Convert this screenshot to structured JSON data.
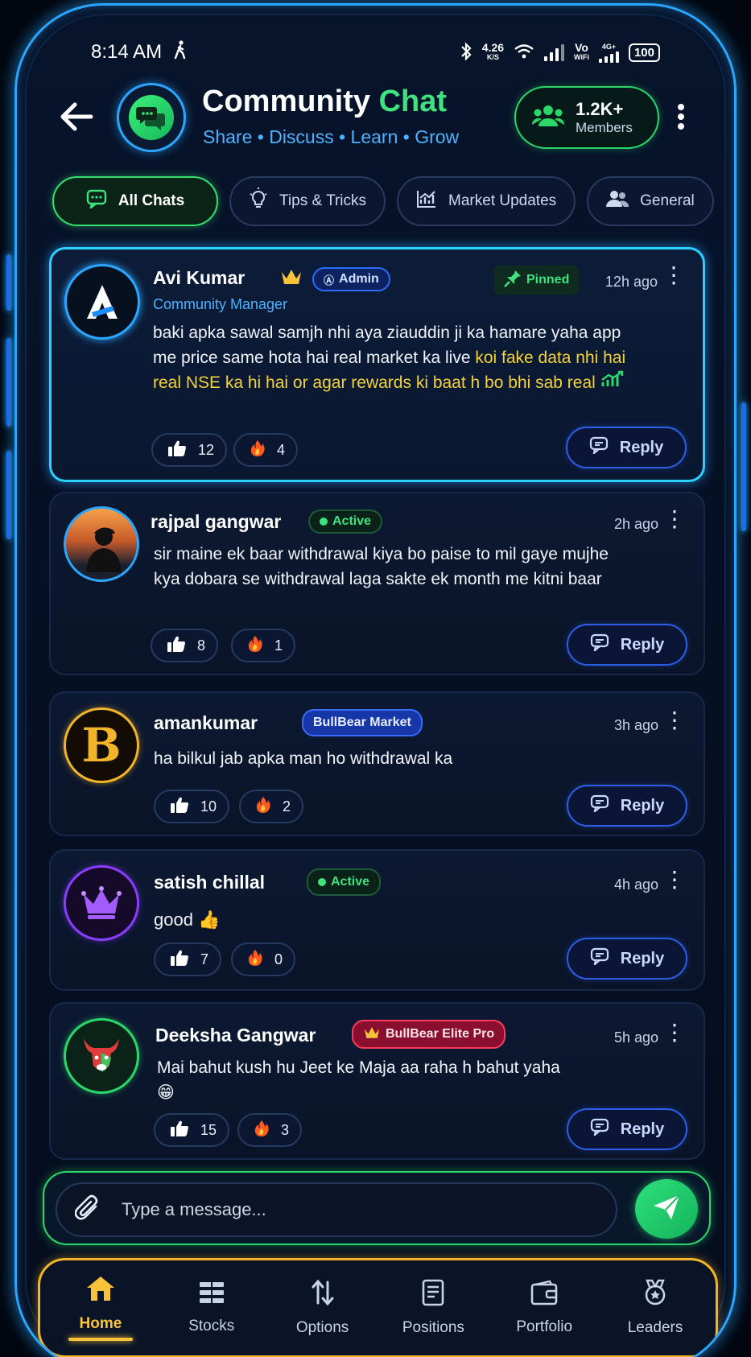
{
  "status_bar": {
    "time": "8:14 AM",
    "speed_value": "4.26",
    "speed_unit": "K/S",
    "vo_wifi_top": "Vo",
    "vo_wifi_bottom": "WiFi",
    "network": "4G+",
    "battery": "100"
  },
  "header": {
    "title_main": "Community",
    "title_accent": "Chat",
    "subtitle": "Share • Discuss • Learn • Grow",
    "members_count": "1.2K+",
    "members_label": "Members"
  },
  "tabs": [
    {
      "label": "All Chats",
      "icon": "chat-icon",
      "active": true
    },
    {
      "label": "Tips & Tricks",
      "icon": "lightbulb-icon",
      "active": false
    },
    {
      "label": "Market Updates",
      "icon": "chart-icon",
      "active": false
    },
    {
      "label": "General",
      "icon": "users-icon",
      "active": false
    }
  ],
  "posts": [
    {
      "user": "Avi Kumar",
      "role_badge": "Admin",
      "subtitle": "Community Manager",
      "pinned_label": "Pinned",
      "time": "12h ago",
      "message": "baki apka sawal samjh nhi aya ziauddin ji ka hamare yaha app me price same hota hai real market ka live",
      "message_highlight": "koi fake data nhi hai real NSE ka hi hai or agar rewards ki baat h bo bhi sab real",
      "likes": "12",
      "fires": "4",
      "reply_label": "Reply"
    },
    {
      "user": "rajpal gangwar",
      "status_badge": "Active",
      "time": "2h ago",
      "message": "sir maine ek baar withdrawal kiya bo paise to mil gaye mujhe kya dobara se withdrawal laga sakte ek month me kitni baar",
      "likes": "8",
      "fires": "1",
      "reply_label": "Reply"
    },
    {
      "user": "amankumar",
      "tier_badge": "BullBear Market",
      "time": "3h ago",
      "message": "ha bilkul jab apka man ho withdrawal ka",
      "likes": "10",
      "fires": "2",
      "reply_label": "Reply"
    },
    {
      "user": "satish chillal",
      "status_badge": "Active",
      "time": "4h ago",
      "message": "good 👍",
      "likes": "7",
      "fires": "0",
      "reply_label": "Reply"
    },
    {
      "user": "Deeksha Gangwar",
      "tier_badge": "BullBear Elite Pro",
      "time": "5h ago",
      "message": "Mai bahut kush hu Jeet ke Maja aa raha h bahut yaha 😁",
      "likes": "15",
      "fires": "3",
      "reply_label": "Reply"
    }
  ],
  "composer": {
    "placeholder": "Type a message..."
  },
  "bottom_nav": [
    {
      "label": "Home",
      "icon": "home-icon",
      "active": true
    },
    {
      "label": "Stocks",
      "icon": "stocks-icon",
      "active": false
    },
    {
      "label": "Options",
      "icon": "options-icon",
      "active": false
    },
    {
      "label": "Positions",
      "icon": "positions-icon",
      "active": false
    },
    {
      "label": "Portfolio",
      "icon": "portfolio-icon",
      "active": false
    },
    {
      "label": "Leaders",
      "icon": "leaders-icon",
      "active": false
    }
  ],
  "colors": {
    "accent_green": "#3ee37f",
    "accent_blue": "#2aa6ff",
    "highlight_yellow": "#f3d23c",
    "nav_gold": "#f6c33a"
  }
}
